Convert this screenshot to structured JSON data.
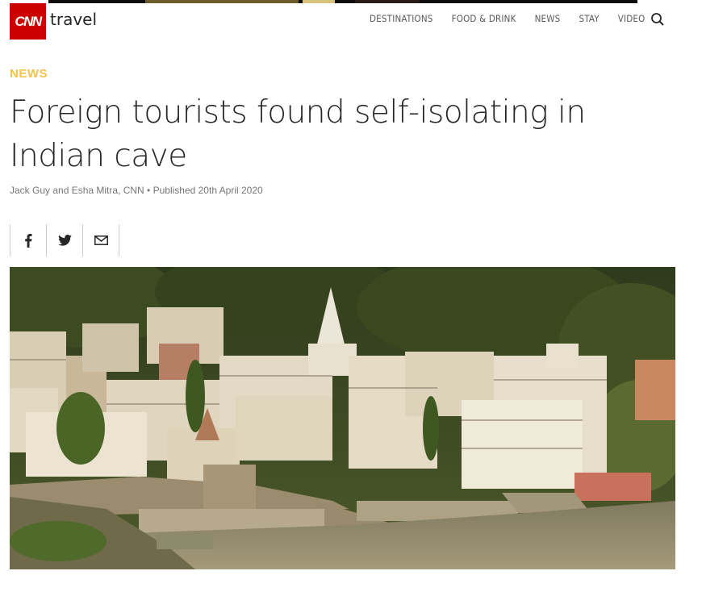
{
  "header": {
    "logo_text": "CNN",
    "brand": "travel",
    "nav": [
      "DESTINATIONS",
      "FOOD & DRINK",
      "NEWS",
      "STAY",
      "VIDEO"
    ],
    "search_icon": "search-icon"
  },
  "article": {
    "kicker": "NEWS",
    "title": "Foreign tourists found self-isolating in Indian cave",
    "byline": "Jack Guy and Esha Mitra, CNN • Published 20th April 2020"
  },
  "share": {
    "icons": [
      "facebook-icon",
      "twitter-icon",
      "email-icon"
    ]
  },
  "colors": {
    "brand_red": "#cc0000",
    "kicker_yellow": "#f2c34b",
    "text": "#262626",
    "muted": "#767676"
  }
}
